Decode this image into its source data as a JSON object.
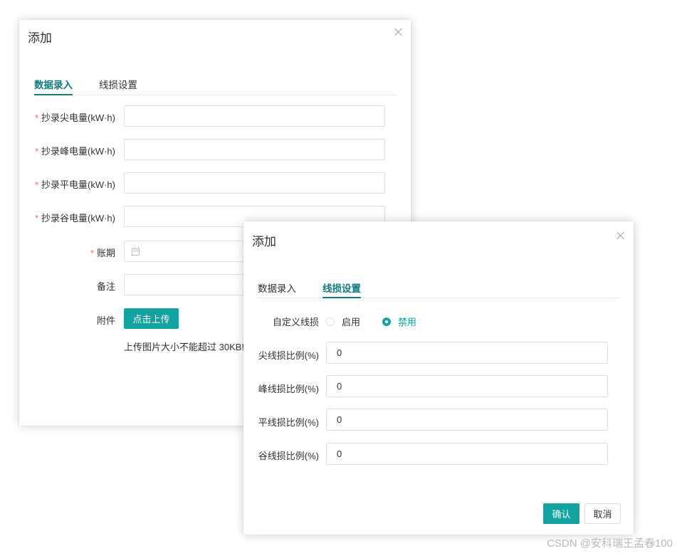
{
  "dialog1": {
    "title": "添加",
    "tabs": [
      {
        "label": "数据录入",
        "active": true
      },
      {
        "label": "线损设置",
        "active": false
      }
    ],
    "fields": [
      {
        "label": "抄录尖电量(kW·h)",
        "required": true,
        "value": ""
      },
      {
        "label": "抄录峰电量(kW·h)",
        "required": true,
        "value": ""
      },
      {
        "label": "抄录平电量(kW·h)",
        "required": true,
        "value": ""
      },
      {
        "label": "抄录谷电量(kW·h)",
        "required": true,
        "value": ""
      },
      {
        "label": "账期",
        "required": true,
        "value": ""
      },
      {
        "label": "备注",
        "required": false,
        "value": ""
      }
    ],
    "attachment_label": "附件",
    "upload_button": "点击上传",
    "upload_hint": "上传图片大小不能超过 30KB!"
  },
  "dialog2": {
    "title": "添加",
    "tabs": [
      {
        "label": "数据录入",
        "active": false
      },
      {
        "label": "线损设置",
        "active": true
      }
    ],
    "custom_loss_label": "自定义线损",
    "radio_options": [
      {
        "label": "启用",
        "checked": false
      },
      {
        "label": "禁用",
        "checked": true
      }
    ],
    "fields": [
      {
        "label": "尖线损比例(%)",
        "value": "0"
      },
      {
        "label": "峰线损比例(%)",
        "value": "0"
      },
      {
        "label": "平线损比例(%)",
        "value": "0"
      },
      {
        "label": "谷线损比例(%)",
        "value": "0"
      }
    ],
    "confirm_button": "确认",
    "cancel_button": "取消"
  },
  "watermark": "CSDN @安科瑞王孟春100",
  "colors": {
    "accent": "#12a2a0",
    "tab_active": "#117a7e",
    "required_star": "#f56c6c"
  },
  "icons": {
    "close": "close-icon",
    "date": "calendar-icon"
  }
}
